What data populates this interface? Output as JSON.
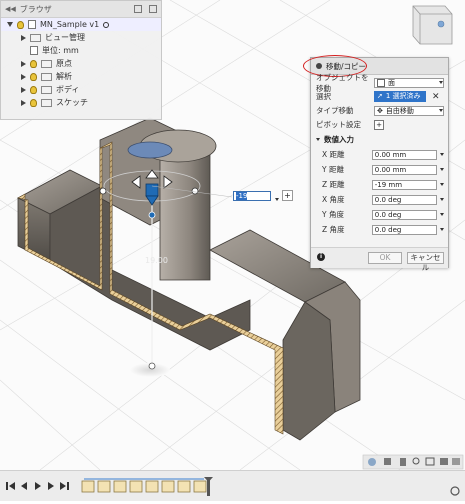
{
  "browser": {
    "title": "ブラウザ",
    "document_name": "MN_Sample v1",
    "items": [
      {
        "label": "ビュー管理"
      },
      {
        "label": "単位: mm"
      },
      {
        "label": "原点"
      },
      {
        "label": "解析"
      },
      {
        "label": "ボディ"
      },
      {
        "label": "スケッチ"
      }
    ]
  },
  "dialog": {
    "title": "移動/コピー",
    "rows": [
      {
        "label": "オブジェクトを移動",
        "value": "面"
      },
      {
        "label": "選択",
        "value": "1 選択済み"
      },
      {
        "label": "タイプ移動",
        "value": "自由移動"
      },
      {
        "label": "ピボット設定",
        "value": ""
      }
    ],
    "section_label": "数値入力",
    "numeric": [
      {
        "label": "X 距離",
        "value": "0.00 mm"
      },
      {
        "label": "Y 距離",
        "value": "0.00 mm"
      },
      {
        "label": "Z 距離",
        "value": "-19 mm"
      },
      {
        "label": "X 角度",
        "value": "0.0 deg"
      },
      {
        "label": "Y 角度",
        "value": "0.0 deg"
      },
      {
        "label": "Z 角度",
        "value": "0.0 deg"
      }
    ],
    "ok_label": "OK",
    "cancel_label": "キャンセル"
  },
  "viewport": {
    "inline_input_value": "-19",
    "dimension_label": "19.00"
  }
}
